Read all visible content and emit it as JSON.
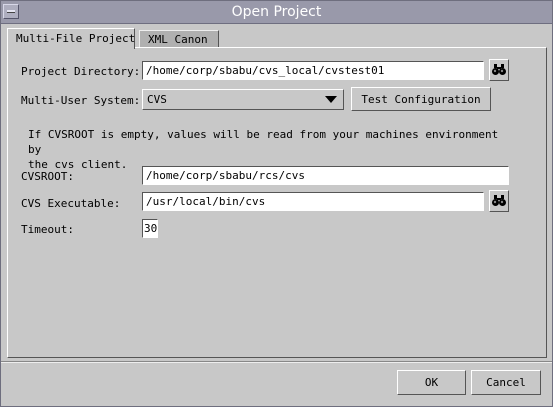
{
  "window": {
    "title": "Open Project"
  },
  "tabs": [
    {
      "label": "Multi-File Project"
    },
    {
      "label": "XML Canon"
    }
  ],
  "form": {
    "project_directory": {
      "label": "Project Directory:",
      "value": "/home/corp/sbabu/cvs_local/cvstest01",
      "browse_icon": "binoculars-icon"
    },
    "multi_user_system": {
      "label": "Multi-User System:",
      "value": "CVS",
      "test_button": "Test Configuration"
    },
    "info_text": "If CVSROOT is empty, values will be read from your machines environment by\nthe cvs client.",
    "cvsroot": {
      "label": "CVSROOT:",
      "value": "/home/corp/sbabu/rcs/cvs"
    },
    "cvs_executable": {
      "label": "CVS Executable:",
      "value": "/usr/local/bin/cvs",
      "browse_icon": "binoculars-icon"
    },
    "timeout": {
      "label": "Timeout:",
      "value": "30"
    }
  },
  "buttons": {
    "ok": "OK",
    "cancel": "Cancel"
  }
}
